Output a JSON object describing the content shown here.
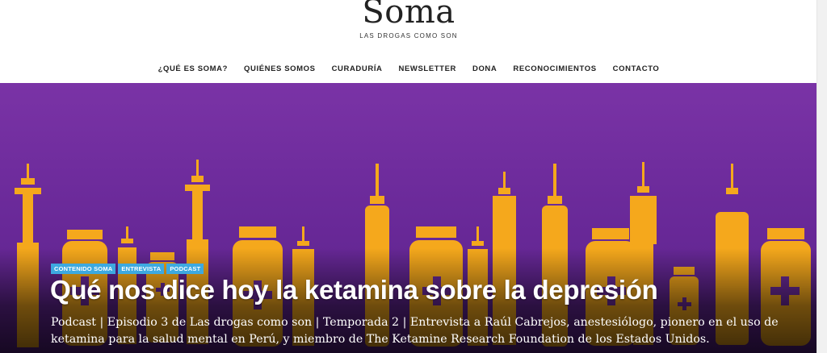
{
  "site": {
    "logo": "Soma",
    "tagline": "LAS DROGAS COMO SON"
  },
  "nav": {
    "items": [
      "¿QUÉ ES SOMA?",
      "QUIÉNES SOMOS",
      "CURADURÍA",
      "NEWSLETTER",
      "DONA",
      "RECONOCIMIENTOS",
      "CONTACTO"
    ]
  },
  "hero": {
    "illustration": "syringes-and-vials",
    "colors": {
      "background": "#6b2a9a",
      "shapes": "#f5a81c",
      "badge": "#3da9e0"
    },
    "badges": [
      "CONTENIDO SOMA",
      "ENTREVISTA",
      "PODCAST"
    ],
    "title": "Qué nos dice hoy la ketamina sobre la depresión",
    "excerpt": "Podcast | Episodio 3 de Las drogas como son | Temporada 2 | Entrevista a Raúl Cabrejos, anestesiólogo, pionero en el uso de ketamina para la salud mental en Perú, y miembro de The Ketamine Research Foundation de los Estados Unidos."
  }
}
